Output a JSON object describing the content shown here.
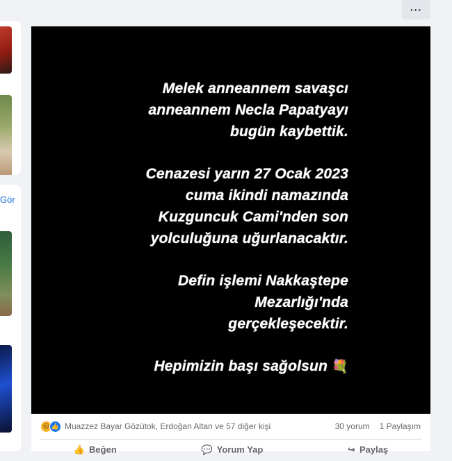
{
  "header": {
    "more_label": "···"
  },
  "sidebar": {
    "see_link": "Gör"
  },
  "post": {
    "lines": [
      [
        "Melek anneannem savaşcı",
        "anneannem Necla Papatyayı",
        "bugün kaybettik."
      ],
      [
        "Cenazesi yarın 27 Ocak 2023",
        "cuma ikindi namazında",
        "Kuzguncuk Cami'nden  son",
        "yolculuğuna uğurlanacaktır."
      ],
      [
        "Defin işlemi Nakkaştepe",
        "Mezarlığı'nda",
        "gerçekleşecektir."
      ]
    ],
    "closing": "Hepimizin başı sağolsun",
    "closing_emoji": "💐",
    "reactions_text": "Muazzez Bayar Gözütok, Erdoğan Altan ve 57 diğer kişi",
    "comments": "30 yorum",
    "shares": "1 Paylaşım",
    "actions": {
      "like": "Beğen",
      "comment": "Yorum Yap",
      "share": "Paylaş"
    }
  },
  "colors": {
    "story_bg": "#000000",
    "like_blue": "#1877f2",
    "sad_yellow": "#f7b125"
  }
}
